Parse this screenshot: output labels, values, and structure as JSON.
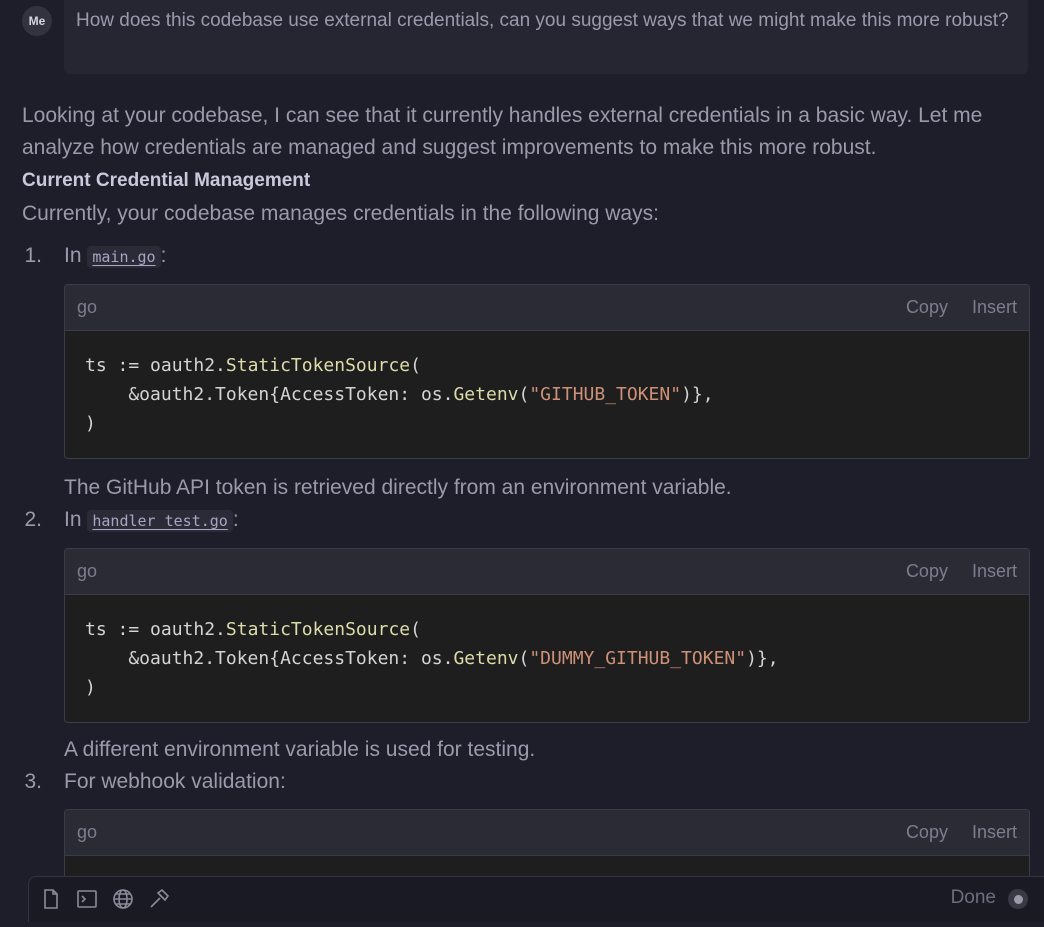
{
  "user": {
    "avatar": "Me",
    "message": "How does this codebase use external credentials, can you suggest ways that we might make this more robust?"
  },
  "answer": {
    "intro": "Looking at your codebase, I can see that it currently handles external credentials in a basic way. Let me analyze how credentials are managed and suggest improvements to make this more robust.",
    "heading": "Current Credential Management",
    "lead": "Currently, your codebase manages credentials in the following ways:",
    "items": [
      {
        "number": "1.",
        "prefix": "In ",
        "code": "main.go",
        "suffix": ":",
        "block": {
          "lang": "go",
          "copy": "Copy",
          "insert": "Insert",
          "lines": [
            {
              "a": "ts := oauth2.",
              "fn": "StaticTokenSource",
              "b": "(",
              "fn2": "",
              "str": "",
              "c": ""
            },
            {
              "a": "    &oauth2.Token{AccessToken: os.",
              "fn": "Getenv",
              "b": "(",
              "str": "\"GITHUB_TOKEN\"",
              "c": ")},"
            },
            {
              "a": ")",
              "fn": "",
              "b": "",
              "str": "",
              "c": ""
            }
          ]
        },
        "description": "The GitHub API token is retrieved directly from an environment variable."
      },
      {
        "number": "2.",
        "prefix": "In ",
        "code": "handler_test.go",
        "suffix": ":",
        "block": {
          "lang": "go",
          "copy": "Copy",
          "insert": "Insert",
          "lines": [
            {
              "a": "ts := oauth2.",
              "fn": "StaticTokenSource",
              "b": "(",
              "str": "",
              "c": ""
            },
            {
              "a": "    &oauth2.Token{AccessToken: os.",
              "fn": "Getenv",
              "b": "(",
              "str": "\"DUMMY_GITHUB_TOKEN\"",
              "c": ")},"
            },
            {
              "a": ")",
              "fn": "",
              "b": "",
              "str": "",
              "c": ""
            }
          ]
        },
        "description": "A different environment variable is used for testing."
      },
      {
        "number": "3.",
        "text": "For webhook validation:",
        "block": {
          "lang": "go",
          "copy": "Copy",
          "insert": "Insert"
        }
      }
    ]
  },
  "toolbar": {
    "icons": [
      "file-icon",
      "terminal-icon",
      "globe-icon",
      "hammer-icon"
    ],
    "status": "Done"
  },
  "colors": {
    "background": "#1e1e2a",
    "code_background": "#1e1e1e",
    "function": "#dcdcaa",
    "string": "#ce9178"
  }
}
